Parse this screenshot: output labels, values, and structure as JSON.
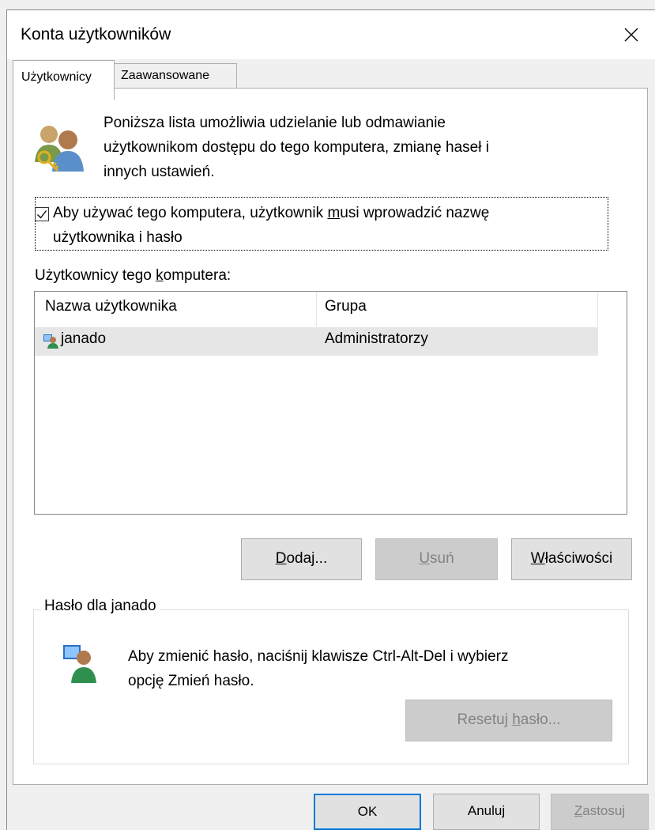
{
  "window": {
    "title": "Konta użytkowników"
  },
  "tabs": [
    {
      "label": "Użytkownicy",
      "active": true
    },
    {
      "label": "Zaawansowane",
      "active": false
    }
  ],
  "intro_lines": [
    "Poniższa lista umożliwia udzielanie lub odmawianie",
    "użytkownikom dostępu do tego komputera, zmianę haseł i",
    "innych ustawień."
  ],
  "require_login": {
    "checked": true,
    "line1_pre": "Aby używać tego komputera, użytkownik ",
    "line1_accel": "m",
    "line1_post": "usi wprowadzić nazwę",
    "line2": "użytkownika i hasło"
  },
  "users_label": {
    "pre": "Użytkownicy tego ",
    "accel": "k",
    "post": "omputera:"
  },
  "user_list": {
    "columns": [
      "Nazwa użytkownika",
      "Grupa"
    ],
    "rows": [
      {
        "name": "janado",
        "group": "Administratorzy",
        "selected": true
      }
    ]
  },
  "buttons": {
    "add": {
      "accel": "D",
      "rest": "odaj..."
    },
    "remove": {
      "accel": "U",
      "rest": "suń"
    },
    "properties": {
      "accel": "W",
      "rest": "łaściwości"
    }
  },
  "password_group": {
    "title": "Hasło dla janado",
    "lines": [
      "Aby zmienić hasło, naciśnij klawisze Ctrl-Alt-Del i wybierz",
      "opcję Zmień hasło."
    ],
    "reset_pre": "Resetuj ",
    "reset_accel": "h",
    "reset_post": "asło..."
  },
  "dialog_buttons": {
    "ok": "OK",
    "cancel": "Anuluj",
    "apply_accel": "Z",
    "apply_rest": "astosuj"
  },
  "colors": {
    "accent": "#0078d7",
    "selected_row": "#e6e6e6",
    "disabled_text": "#838383"
  }
}
